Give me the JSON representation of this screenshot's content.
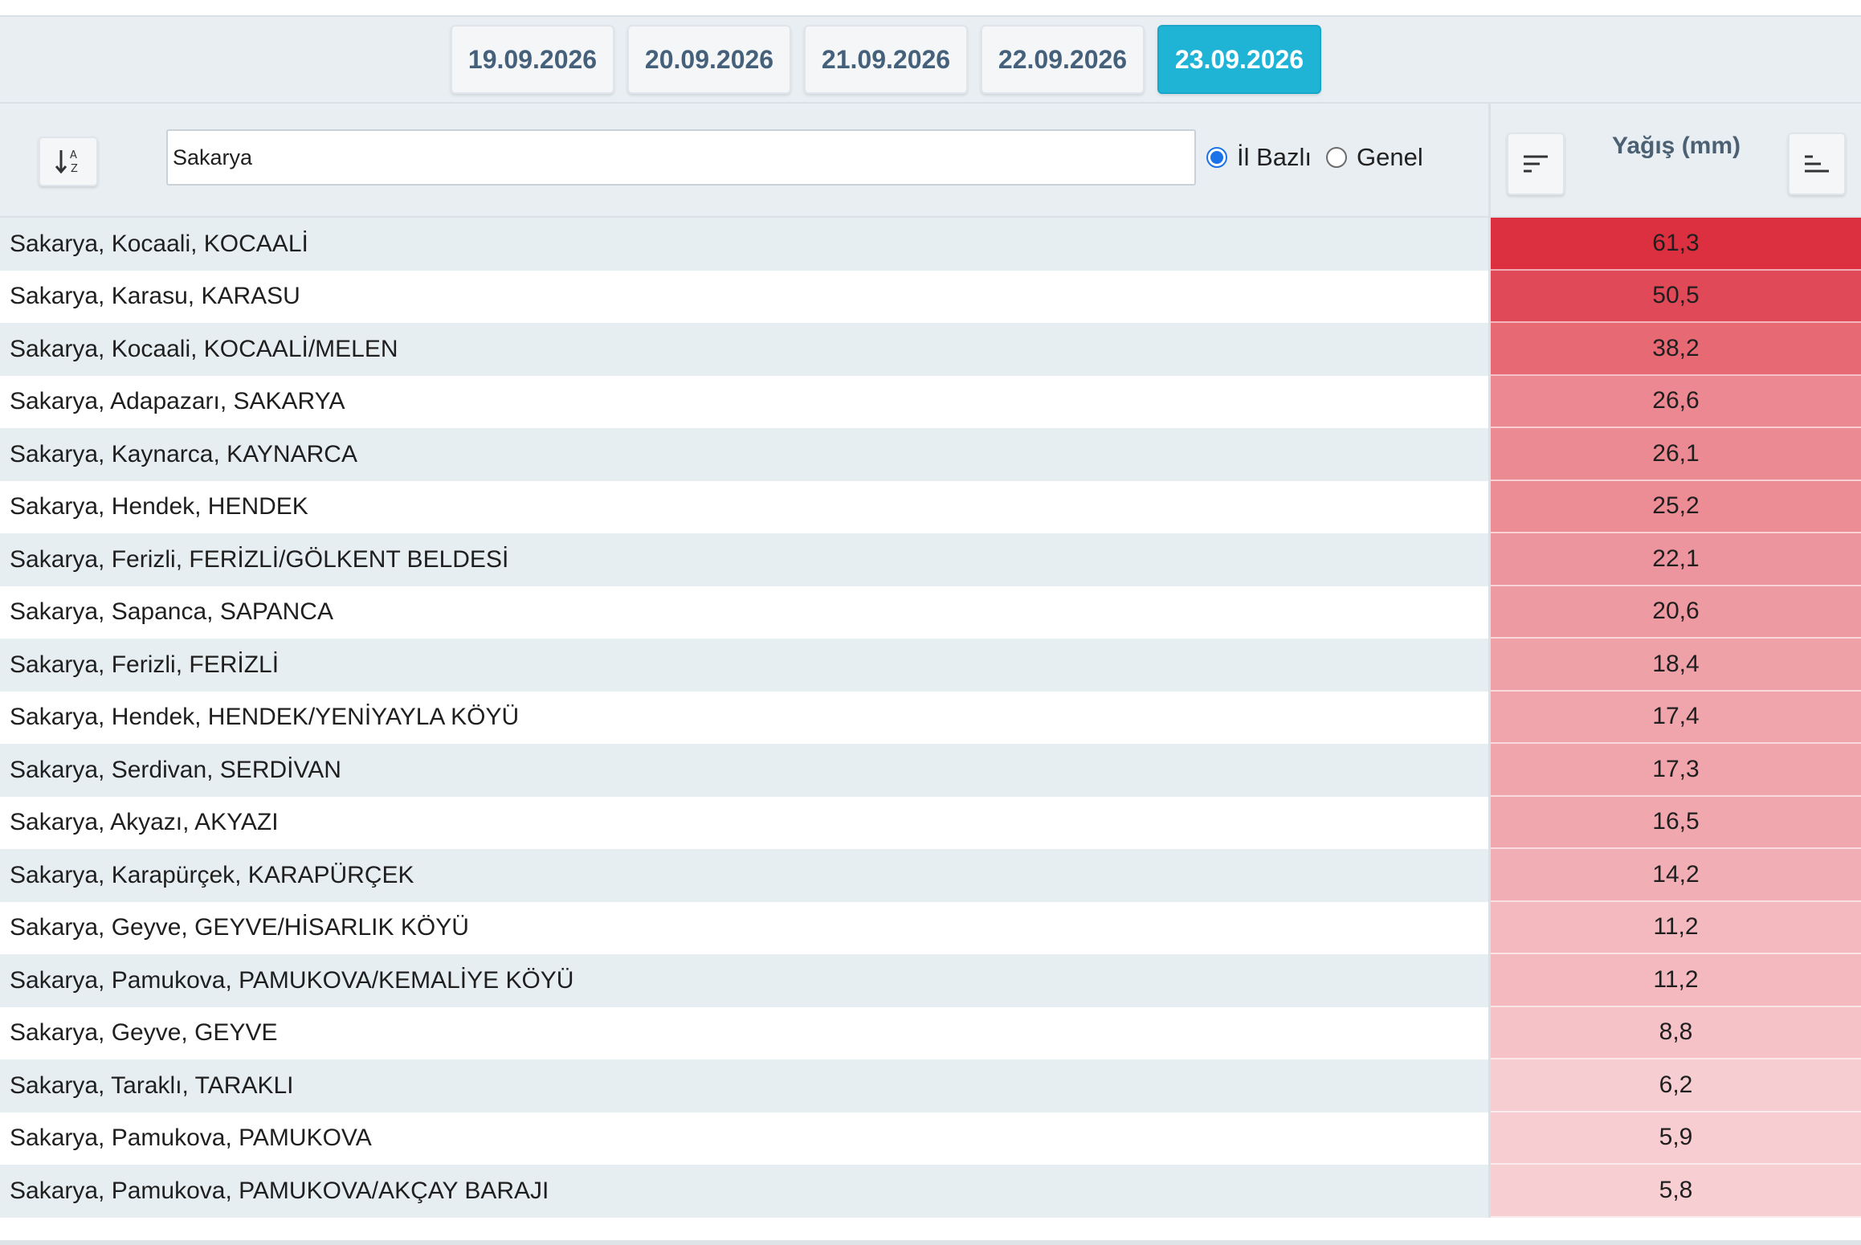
{
  "date_tabs": [
    {
      "label": "19.09.2026",
      "active": false
    },
    {
      "label": "20.09.2026",
      "active": false
    },
    {
      "label": "21.09.2026",
      "active": false
    },
    {
      "label": "22.09.2026",
      "active": false
    },
    {
      "label": "23.09.2026",
      "active": true
    }
  ],
  "toolbar": {
    "sort_az_icon": "sort-alpha-icon",
    "search_value": "Sakarya",
    "radios": [
      {
        "label": "İl Bazlı",
        "checked": true
      },
      {
        "label": "Genel",
        "checked": false
      }
    ],
    "value_header": "Yağış (mm)",
    "sort_desc_icon": "sort-descending-icon",
    "sort_asc_icon": "sort-ascending-icon"
  },
  "colors": {
    "active_tab": "#1fb3d6",
    "heat_max": "#dc3040"
  },
  "rows": [
    {
      "name": "Sakarya, Kocaali, KOCAALİ",
      "value": "61,3"
    },
    {
      "name": "Sakarya, Karasu, KARASU",
      "value": "50,5"
    },
    {
      "name": "Sakarya, Kocaali, KOCAALİ/MELEN",
      "value": "38,2"
    },
    {
      "name": "Sakarya, Adapazarı, SAKARYA",
      "value": "26,6"
    },
    {
      "name": "Sakarya, Kaynarca, KAYNARCA",
      "value": "26,1"
    },
    {
      "name": "Sakarya, Hendek, HENDEK",
      "value": "25,2"
    },
    {
      "name": "Sakarya, Ferizli, FERİZLİ/GÖLKENT BELDESİ",
      "value": "22,1"
    },
    {
      "name": "Sakarya, Sapanca, SAPANCA",
      "value": "20,6"
    },
    {
      "name": "Sakarya, Ferizli, FERİZLİ",
      "value": "18,4"
    },
    {
      "name": "Sakarya, Hendek, HENDEK/YENİYAYLA KÖYÜ",
      "value": "17,4"
    },
    {
      "name": "Sakarya, Serdivan, SERDİVAN",
      "value": "17,3"
    },
    {
      "name": "Sakarya, Akyazı, AKYAZI",
      "value": "16,5"
    },
    {
      "name": "Sakarya, Karapürçek, KARAPÜRÇEK",
      "value": "14,2"
    },
    {
      "name": "Sakarya, Geyve, GEYVE/HİSARLIK KÖYÜ",
      "value": "11,2"
    },
    {
      "name": "Sakarya, Pamukova, PAMUKOVA/KEMALİYE KÖYÜ",
      "value": "11,2"
    },
    {
      "name": "Sakarya, Geyve, GEYVE",
      "value": "8,8"
    },
    {
      "name": "Sakarya, Taraklı, TARAKLI",
      "value": "6,2"
    },
    {
      "name": "Sakarya, Pamukova, PAMUKOVA",
      "value": "5,9"
    },
    {
      "name": "Sakarya, Pamukova, PAMUKOVA/AKÇAY BARAJI",
      "value": "5,8"
    }
  ]
}
